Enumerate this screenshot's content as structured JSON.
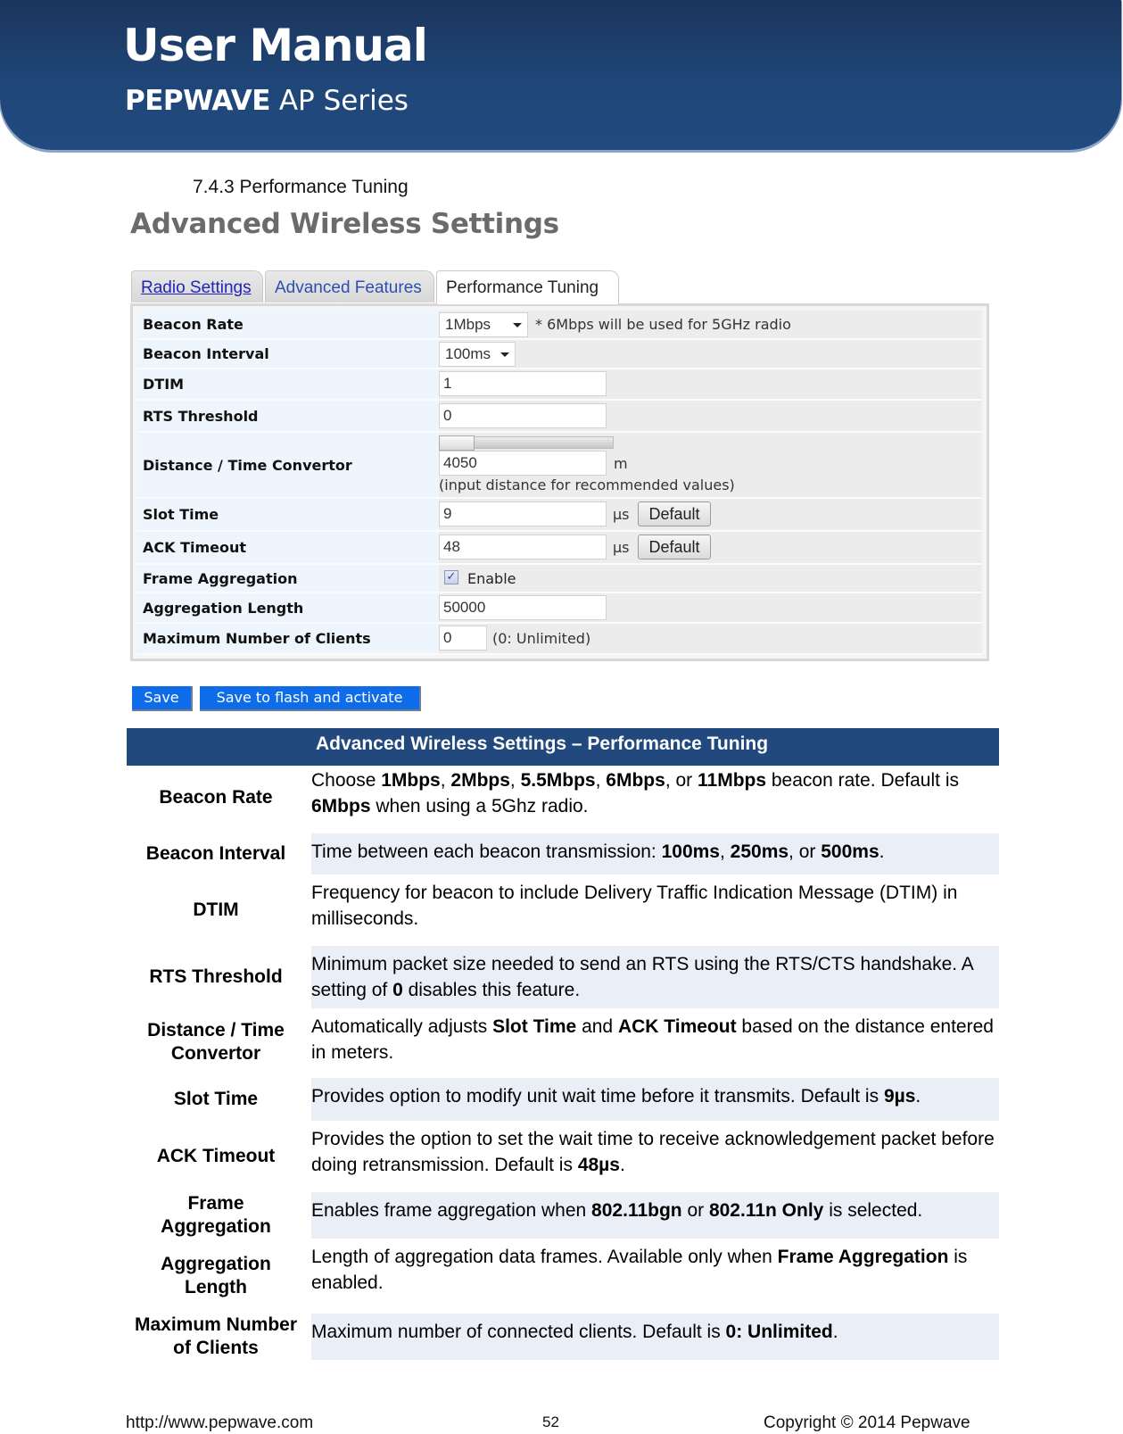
{
  "banner": {
    "title": "User Manual",
    "brand": "PEPWAVE",
    "series": "AP Series"
  },
  "section_title": "7.4.3 Performance Tuning",
  "screenshot": {
    "heading": "Advanced Wireless Settings",
    "tabs": [
      {
        "label": "Radio Settings",
        "active": false
      },
      {
        "label": "Advanced Features",
        "active": false
      },
      {
        "label": "Performance Tuning",
        "active": true
      }
    ],
    "fields": {
      "beacon_rate": {
        "label": "Beacon Rate",
        "value": "1Mbps",
        "note": "* 6Mbps will be used for 5GHz radio"
      },
      "beacon_interval": {
        "label": "Beacon Interval",
        "value": "100ms"
      },
      "dtim": {
        "label": "DTIM",
        "value": "1"
      },
      "rts_threshold": {
        "label": "RTS Threshold",
        "value": "0"
      },
      "distance": {
        "label": "Distance / Time Convertor",
        "value": "4050",
        "unit": "m",
        "hint": "(input distance for recommended values)",
        "slider_fraction": 0.0
      },
      "slot_time": {
        "label": "Slot Time",
        "value": "9",
        "unit": "µs",
        "button": "Default"
      },
      "ack_timeout": {
        "label": "ACK Timeout",
        "value": "48",
        "unit": "µs",
        "button": "Default"
      },
      "frame_aggregation": {
        "label": "Frame Aggregation",
        "checked": true,
        "check_mark": "✓",
        "option": "Enable"
      },
      "aggregation_length": {
        "label": "Aggregation Length",
        "value": "50000"
      },
      "max_clients": {
        "label": "Maximum Number of Clients",
        "value": "0",
        "note": "(0: Unlimited)"
      }
    },
    "buttons": {
      "save": "Save",
      "save_activate": "Save to flash and activate"
    }
  },
  "table": {
    "header": "Advanced Wireless Settings – Performance Tuning",
    "rows": [
      {
        "label": "Beacon Rate",
        "desc_html": "Choose <b>1Mbps</b>, <b>2Mbps</b>, <b>5.5Mbps</b>, <b>6Mbps</b>, or <b>11Mbps</b> beacon rate. Default is <b>6Mbps</b> when using a 5Ghz radio."
      },
      {
        "label": "Beacon Interval",
        "desc_html": "Time between each beacon transmission: <b>100ms</b>, <b>250ms</b>, or <b>500ms</b>."
      },
      {
        "label": "DTIM",
        "desc_html": "Frequency for beacon to include Delivery Traffic Indication Message (DTIM) in milliseconds."
      },
      {
        "label": "RTS Threshold",
        "desc_html": "Minimum packet size needed to send an RTS using the RTS/CTS handshake. A setting of <b>0</b> disables this feature."
      },
      {
        "label": "Distance / Time Convertor",
        "desc_html": "Automatically adjusts <b>Slot Time</b> and <b>ACK Timeout</b> based on the distance entered in meters."
      },
      {
        "label": "Slot Time",
        "desc_html": "Provides option to modify unit wait time before it transmits. Default is <b>9µs</b>."
      },
      {
        "label": "ACK Timeout",
        "desc_html": "Provides the option to set the wait time to receive acknowledgement packet before doing retransmission. Default is <b>48µs</b>."
      },
      {
        "label": "Frame Aggregation",
        "desc_html": "Enables frame aggregation when <b>802.11bgn</b> or <b>802.11n Only</b> is selected."
      },
      {
        "label": "Aggregation Length",
        "desc_html": "Length of aggregation data frames. Available only when <b>Frame Aggregation</b> is enabled."
      },
      {
        "label": "Maximum Number of Clients",
        "desc_html": "Maximum number of connected clients. Default is <b>0: Unlimited</b>."
      }
    ]
  },
  "footer": {
    "url": "http://www.pepwave.com",
    "page": "52",
    "copyright": "Copyright © 2014 Pepwave"
  }
}
